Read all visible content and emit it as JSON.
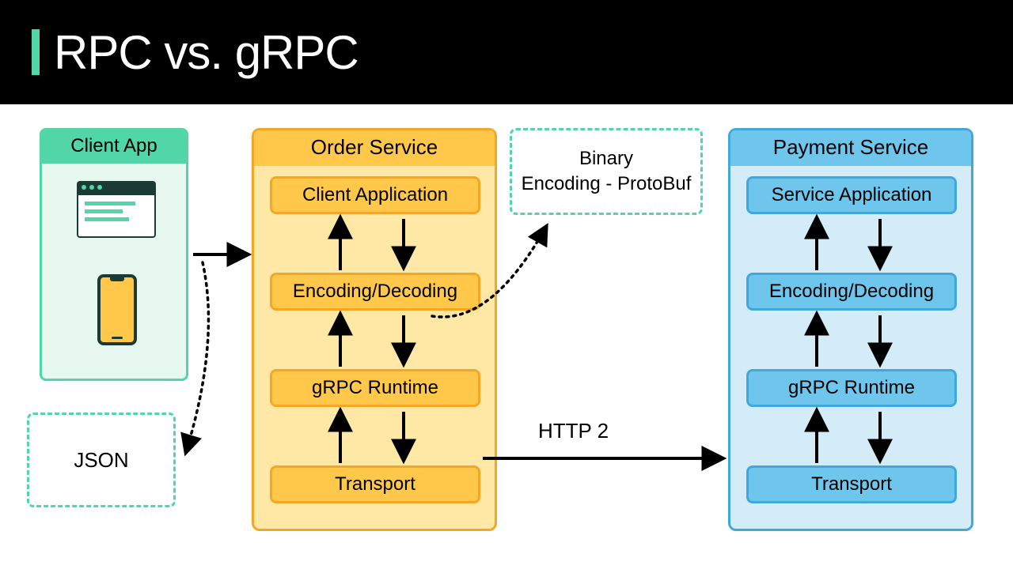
{
  "title": "RPC vs. gRPC",
  "client": {
    "title": "Client App"
  },
  "json_box": "JSON",
  "order": {
    "title": "Order Service",
    "layers": {
      "app": "Client Application",
      "encode": "Encoding/Decoding",
      "runtime": "gRPC Runtime",
      "transport": "Transport"
    }
  },
  "payment": {
    "title": "Payment Service",
    "layers": {
      "app": "Service Application",
      "encode": "Encoding/Decoding",
      "runtime": "gRPC Runtime",
      "transport": "Transport"
    }
  },
  "protobuf": {
    "line1": "Binary",
    "line2": "Encoding - ProtoBuf"
  },
  "http2": "HTTP 2"
}
